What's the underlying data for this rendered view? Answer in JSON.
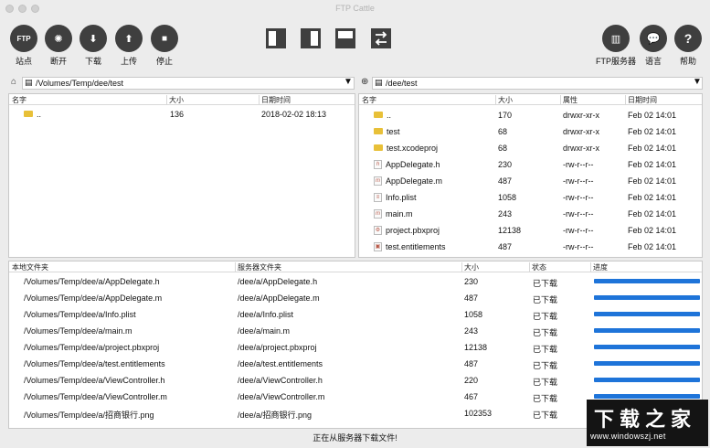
{
  "window": {
    "title": "FTP Cattle"
  },
  "toolbar": {
    "left": [
      {
        "label": "站点",
        "icon": "FTP",
        "name": "sites"
      },
      {
        "label": "断开",
        "icon": "✺",
        "name": "disconnect"
      },
      {
        "label": "下载",
        "icon": "⬇",
        "name": "download"
      },
      {
        "label": "上传",
        "icon": "⬆",
        "name": "upload"
      },
      {
        "label": "停止",
        "icon": "■",
        "name": "stop"
      }
    ],
    "right": [
      {
        "label": "FTP服务器",
        "icon": "▥",
        "name": "ftp-server"
      },
      {
        "label": "语言",
        "icon": "💬",
        "name": "language"
      },
      {
        "label": "帮助",
        "icon": "?",
        "name": "help"
      }
    ]
  },
  "local": {
    "path": "/Volumes/Temp/dee/test",
    "columns": [
      "名字",
      "大小",
      "日期时间"
    ],
    "rows": [
      {
        "name": "..",
        "size": "136",
        "date": "2018-02-02 18:13",
        "type": "folder"
      }
    ]
  },
  "remote": {
    "path": "/dee/test",
    "columns": [
      "名字",
      "大小",
      "属性",
      "日期时间"
    ],
    "rows": [
      {
        "name": "..",
        "size": "170",
        "attr": "drwxr-xr-x",
        "date": "Feb 02 14:01",
        "type": "folder"
      },
      {
        "name": "test",
        "size": "68",
        "attr": "drwxr-xr-x",
        "date": "Feb 02 14:01",
        "type": "folder"
      },
      {
        "name": "test.xcodeproj",
        "size": "68",
        "attr": "drwxr-xr-x",
        "date": "Feb 02 14:01",
        "type": "folder"
      },
      {
        "name": "AppDelegate.h",
        "size": "230",
        "attr": "-rw-r--r--",
        "date": "Feb 02 14:01",
        "type": "h"
      },
      {
        "name": "AppDelegate.m",
        "size": "487",
        "attr": "-rw-r--r--",
        "date": "Feb 02 14:01",
        "type": "m"
      },
      {
        "name": "Info.plist",
        "size": "1058",
        "attr": "-rw-r--r--",
        "date": "Feb 02 14:01",
        "type": "plist"
      },
      {
        "name": "main.m",
        "size": "243",
        "attr": "-rw-r--r--",
        "date": "Feb 02 14:01",
        "type": "m"
      },
      {
        "name": "project.pbxproj",
        "size": "12138",
        "attr": "-rw-r--r--",
        "date": "Feb 02 14:01",
        "type": "pbx"
      },
      {
        "name": "test.entitlements",
        "size": "487",
        "attr": "-rw-r--r--",
        "date": "Feb 02 14:01",
        "type": "ent"
      }
    ]
  },
  "queue": {
    "columns": [
      "本地文件夹",
      "服务器文件夹",
      "大小",
      "状态",
      "进度"
    ],
    "rows": [
      {
        "local": "/Volumes/Temp/dee/a/AppDelegate.h",
        "remote": "/dee/a/AppDelegate.h",
        "size": "230",
        "status": "已下载",
        "progress": 1.0
      },
      {
        "local": "/Volumes/Temp/dee/a/AppDelegate.m",
        "remote": "/dee/a/AppDelegate.m",
        "size": "487",
        "status": "已下载",
        "progress": 1.0
      },
      {
        "local": "/Volumes/Temp/dee/a/Info.plist",
        "remote": "/dee/a/Info.plist",
        "size": "1058",
        "status": "已下载",
        "progress": 1.0
      },
      {
        "local": "/Volumes/Temp/dee/a/main.m",
        "remote": "/dee/a/main.m",
        "size": "243",
        "status": "已下载",
        "progress": 1.0
      },
      {
        "local": "/Volumes/Temp/dee/a/project.pbxproj",
        "remote": "/dee/a/project.pbxproj",
        "size": "12138",
        "status": "已下载",
        "progress": 1.0
      },
      {
        "local": "/Volumes/Temp/dee/a/test.entitlements",
        "remote": "/dee/a/test.entitlements",
        "size": "487",
        "status": "已下载",
        "progress": 1.0
      },
      {
        "local": "/Volumes/Temp/dee/a/ViewController.h",
        "remote": "/dee/a/ViewController.h",
        "size": "220",
        "status": "已下载",
        "progress": 1.0
      },
      {
        "local": "/Volumes/Temp/dee/a/ViewController.m",
        "remote": "/dee/a/ViewController.m",
        "size": "467",
        "status": "已下载",
        "progress": 1.0
      },
      {
        "local": "/Volumes/Temp/dee/a/招商银行.png",
        "remote": "/dee/a/招商银行.png",
        "size": "102353",
        "status": "已下载",
        "progress": 1.0
      }
    ]
  },
  "status_text": "正在从服务器下载文件!",
  "watermark": {
    "title": "下载之家",
    "url": "www.windowszj.net"
  },
  "colors": {
    "accent": "#1e74d9",
    "toolbar_icon": "#3f3f3f",
    "folder": "#e8c038"
  }
}
